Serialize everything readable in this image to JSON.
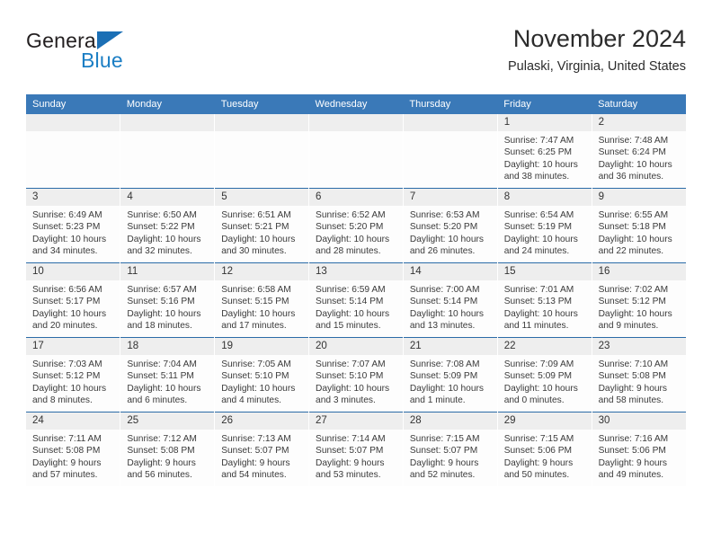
{
  "brand": {
    "name_part1": "General",
    "name_part2": "Blue",
    "triangle_icon": "brand-triangle-icon",
    "color_dark": "#231f20",
    "color_blue": "#1b7ec4"
  },
  "header": {
    "title": "November 2024",
    "subtitle": "Pulaski, Virginia, United States"
  },
  "theme": {
    "header_bg": "#3a79b8",
    "row_divider": "#2b6ca8",
    "daynum_bg": "#eeeeee",
    "cell_bg": "#fdfdfd"
  },
  "columns": [
    "Sunday",
    "Monday",
    "Tuesday",
    "Wednesday",
    "Thursday",
    "Friday",
    "Saturday"
  ],
  "labels": {
    "sunrise_prefix": "Sunrise: ",
    "sunset_prefix": "Sunset: ",
    "daylight_prefix": "Daylight: "
  },
  "weeks": [
    [
      {
        "day": "",
        "empty": true
      },
      {
        "day": "",
        "empty": true
      },
      {
        "day": "",
        "empty": true
      },
      {
        "day": "",
        "empty": true
      },
      {
        "day": "",
        "empty": true
      },
      {
        "day": "1",
        "sunrise": "Sunrise: 7:47 AM",
        "sunset": "Sunset: 6:25 PM",
        "daylight": "Daylight: 10 hours and 38 minutes."
      },
      {
        "day": "2",
        "sunrise": "Sunrise: 7:48 AM",
        "sunset": "Sunset: 6:24 PM",
        "daylight": "Daylight: 10 hours and 36 minutes."
      }
    ],
    [
      {
        "day": "3",
        "sunrise": "Sunrise: 6:49 AM",
        "sunset": "Sunset: 5:23 PM",
        "daylight": "Daylight: 10 hours and 34 minutes."
      },
      {
        "day": "4",
        "sunrise": "Sunrise: 6:50 AM",
        "sunset": "Sunset: 5:22 PM",
        "daylight": "Daylight: 10 hours and 32 minutes."
      },
      {
        "day": "5",
        "sunrise": "Sunrise: 6:51 AM",
        "sunset": "Sunset: 5:21 PM",
        "daylight": "Daylight: 10 hours and 30 minutes."
      },
      {
        "day": "6",
        "sunrise": "Sunrise: 6:52 AM",
        "sunset": "Sunset: 5:20 PM",
        "daylight": "Daylight: 10 hours and 28 minutes."
      },
      {
        "day": "7",
        "sunrise": "Sunrise: 6:53 AM",
        "sunset": "Sunset: 5:20 PM",
        "daylight": "Daylight: 10 hours and 26 minutes."
      },
      {
        "day": "8",
        "sunrise": "Sunrise: 6:54 AM",
        "sunset": "Sunset: 5:19 PM",
        "daylight": "Daylight: 10 hours and 24 minutes."
      },
      {
        "day": "9",
        "sunrise": "Sunrise: 6:55 AM",
        "sunset": "Sunset: 5:18 PM",
        "daylight": "Daylight: 10 hours and 22 minutes."
      }
    ],
    [
      {
        "day": "10",
        "sunrise": "Sunrise: 6:56 AM",
        "sunset": "Sunset: 5:17 PM",
        "daylight": "Daylight: 10 hours and 20 minutes."
      },
      {
        "day": "11",
        "sunrise": "Sunrise: 6:57 AM",
        "sunset": "Sunset: 5:16 PM",
        "daylight": "Daylight: 10 hours and 18 minutes."
      },
      {
        "day": "12",
        "sunrise": "Sunrise: 6:58 AM",
        "sunset": "Sunset: 5:15 PM",
        "daylight": "Daylight: 10 hours and 17 minutes."
      },
      {
        "day": "13",
        "sunrise": "Sunrise: 6:59 AM",
        "sunset": "Sunset: 5:14 PM",
        "daylight": "Daylight: 10 hours and 15 minutes."
      },
      {
        "day": "14",
        "sunrise": "Sunrise: 7:00 AM",
        "sunset": "Sunset: 5:14 PM",
        "daylight": "Daylight: 10 hours and 13 minutes."
      },
      {
        "day": "15",
        "sunrise": "Sunrise: 7:01 AM",
        "sunset": "Sunset: 5:13 PM",
        "daylight": "Daylight: 10 hours and 11 minutes."
      },
      {
        "day": "16",
        "sunrise": "Sunrise: 7:02 AM",
        "sunset": "Sunset: 5:12 PM",
        "daylight": "Daylight: 10 hours and 9 minutes."
      }
    ],
    [
      {
        "day": "17",
        "sunrise": "Sunrise: 7:03 AM",
        "sunset": "Sunset: 5:12 PM",
        "daylight": "Daylight: 10 hours and 8 minutes."
      },
      {
        "day": "18",
        "sunrise": "Sunrise: 7:04 AM",
        "sunset": "Sunset: 5:11 PM",
        "daylight": "Daylight: 10 hours and 6 minutes."
      },
      {
        "day": "19",
        "sunrise": "Sunrise: 7:05 AM",
        "sunset": "Sunset: 5:10 PM",
        "daylight": "Daylight: 10 hours and 4 minutes."
      },
      {
        "day": "20",
        "sunrise": "Sunrise: 7:07 AM",
        "sunset": "Sunset: 5:10 PM",
        "daylight": "Daylight: 10 hours and 3 minutes."
      },
      {
        "day": "21",
        "sunrise": "Sunrise: 7:08 AM",
        "sunset": "Sunset: 5:09 PM",
        "daylight": "Daylight: 10 hours and 1 minute."
      },
      {
        "day": "22",
        "sunrise": "Sunrise: 7:09 AM",
        "sunset": "Sunset: 5:09 PM",
        "daylight": "Daylight: 10 hours and 0 minutes."
      },
      {
        "day": "23",
        "sunrise": "Sunrise: 7:10 AM",
        "sunset": "Sunset: 5:08 PM",
        "daylight": "Daylight: 9 hours and 58 minutes."
      }
    ],
    [
      {
        "day": "24",
        "sunrise": "Sunrise: 7:11 AM",
        "sunset": "Sunset: 5:08 PM",
        "daylight": "Daylight: 9 hours and 57 minutes."
      },
      {
        "day": "25",
        "sunrise": "Sunrise: 7:12 AM",
        "sunset": "Sunset: 5:08 PM",
        "daylight": "Daylight: 9 hours and 56 minutes."
      },
      {
        "day": "26",
        "sunrise": "Sunrise: 7:13 AM",
        "sunset": "Sunset: 5:07 PM",
        "daylight": "Daylight: 9 hours and 54 minutes."
      },
      {
        "day": "27",
        "sunrise": "Sunrise: 7:14 AM",
        "sunset": "Sunset: 5:07 PM",
        "daylight": "Daylight: 9 hours and 53 minutes."
      },
      {
        "day": "28",
        "sunrise": "Sunrise: 7:15 AM",
        "sunset": "Sunset: 5:07 PM",
        "daylight": "Daylight: 9 hours and 52 minutes."
      },
      {
        "day": "29",
        "sunrise": "Sunrise: 7:15 AM",
        "sunset": "Sunset: 5:06 PM",
        "daylight": "Daylight: 9 hours and 50 minutes."
      },
      {
        "day": "30",
        "sunrise": "Sunrise: 7:16 AM",
        "sunset": "Sunset: 5:06 PM",
        "daylight": "Daylight: 9 hours and 49 minutes."
      }
    ]
  ]
}
